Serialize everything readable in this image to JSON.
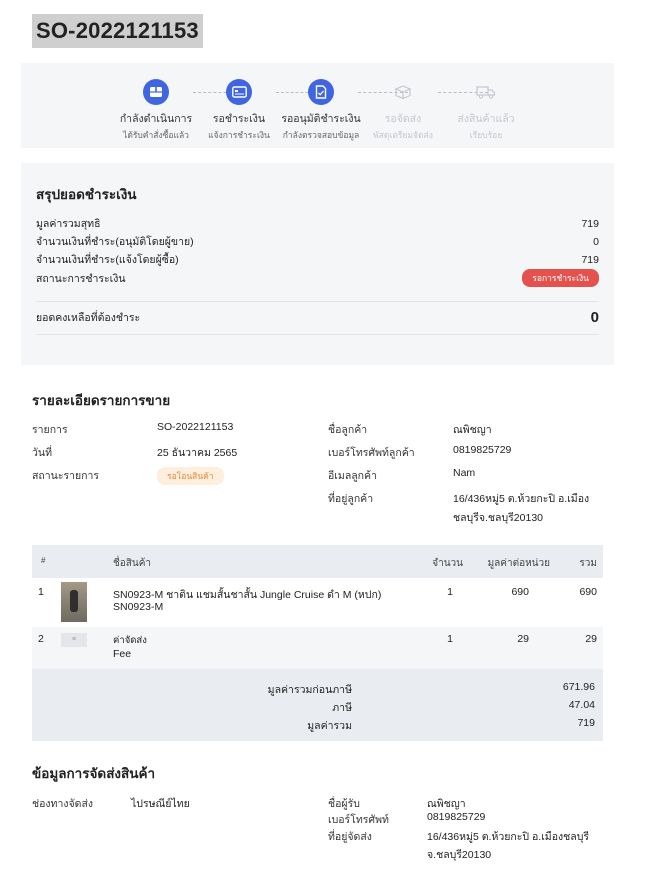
{
  "order": {
    "number": "SO-2022121153"
  },
  "stepper": {
    "steps": [
      {
        "label": "กำลังดำเนินการ",
        "sub": "ได้รับคำสั่งซื้อแล้ว",
        "icon": "box-icon",
        "state": "active"
      },
      {
        "label": "รอชำระเงิน",
        "sub": "แจ้งการชำระเงิน",
        "icon": "payment-card-icon",
        "state": "active"
      },
      {
        "label": "รออนุมัติชำระเงิน",
        "sub": "กำลังตรวจสอบข้อมูล",
        "icon": "document-check-icon",
        "state": "active"
      },
      {
        "label": "รอจัดส่ง",
        "sub": "พัสดุเตรียมจัดส่ง",
        "icon": "package-icon",
        "state": "inactive"
      },
      {
        "label": "ส่งสินค้าแล้ว",
        "sub": "เรียบร้อย",
        "icon": "truck-icon",
        "state": "inactive"
      }
    ],
    "active_color": "#3f66e0"
  },
  "payment": {
    "title": "สรุปยอดชำระเงิน",
    "rows": [
      {
        "label": "มูลค่ารวมสุทธิ",
        "value": "719"
      },
      {
        "label": "จำนวนเงินที่ชำระ(อนุมัติโดยผู้ขาย)",
        "value": "0"
      },
      {
        "label": "จำนวนเงินที่ชำระ(แจ้งโดยผู้ซื้อ)",
        "value": "719"
      }
    ],
    "status_label": "สถานะการชำระเงิน",
    "status_badge": "รอการชำระเงิน",
    "status_color": "#e5524d",
    "balance_label": "ยอดคงเหลือที่ต้องชำระ",
    "balance_value": "0"
  },
  "sale": {
    "title": "รายละเอียดรายการขาย",
    "order_label": "รายการ",
    "order_value": "SO-2022121153",
    "date_label": "วันที่",
    "date_value": "25 ธันวาคม 2565",
    "status_label": "สถานะรายการ",
    "status_badge": "รอโอนสินค้า",
    "customer_name_label": "ชื่อลูกค้า",
    "customer_name": "ณพิชญา",
    "customer_phone_label": "เบอร์โทรศัพท์ลูกค้า",
    "customer_phone": "0819825729",
    "customer_email_label": "อีเมลลูกค้า",
    "customer_email": "Nam",
    "customer_address_label": "ที่อยู่ลูกค้า",
    "customer_address_line1": "16/436หมู่5 ต.ห้วยกะปิ อ.เมือง",
    "customer_address_line2": "ชลบุรีจ.ชลบุรี20130"
  },
  "items_table": {
    "headers": {
      "index": "#",
      "name": "ชื่อสินค้า",
      "qty": "จำนวน",
      "unit_price": "มูลค่าต่อหน่วย",
      "total": "รวม"
    },
    "rows": [
      {
        "index": "1",
        "name_line1": "SN0923-M ชาติน แชมสั้นชาสั้น Jungle Cruise ดำ M (หปก)",
        "name_line2": "SN0923-M",
        "qty": "1",
        "unit_price": "690",
        "total": "690"
      },
      {
        "index": "2",
        "name_line1": "ค่าจัดส่ง",
        "name_line2": "Fee",
        "qty": "1",
        "unit_price": "29",
        "total": "29"
      }
    ],
    "summary": [
      {
        "label": "มูลค่ารวมก่อนภาษี",
        "value": "671.96"
      },
      {
        "label": "ภาษี",
        "value": "47.04"
      },
      {
        "label": "มูลค่ารวม",
        "value": "719"
      }
    ]
  },
  "shipping": {
    "title": "ข้อมูลการจัดส่งสินค้า",
    "channel_label": "ช่องทางจัดส่ง",
    "channel_value": "ไปรษณีย์ไทย",
    "recipient_label": "ชื่อผู้รับ",
    "recipient_value": "ณพิชญา",
    "phone_label": "เบอร์โทรศัพท์",
    "phone_value": "0819825729",
    "address_label": "ที่อยู่จัดส่ง",
    "address_line1": "16/436หมู่5 ต.ห้วยกะปิ อ.เมืองชลบุรี",
    "address_line2": "จ.ชลบุรี20130"
  }
}
